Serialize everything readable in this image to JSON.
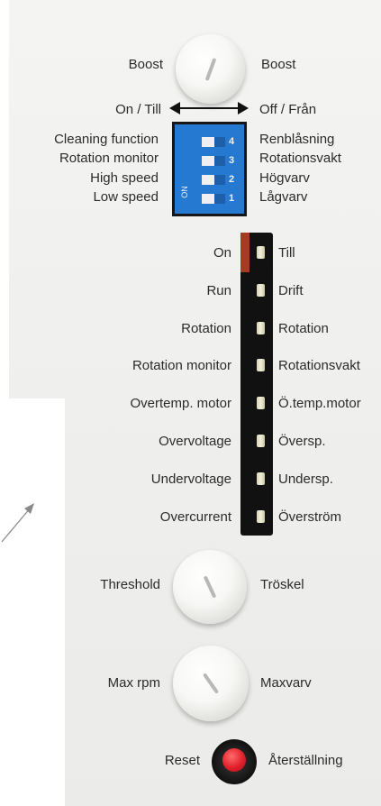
{
  "boost": {
    "left": "Boost",
    "right": "Boost"
  },
  "direction": {
    "left": "On / Till",
    "right": "Off / Från"
  },
  "dip_switch": {
    "left_labels": [
      "Cleaning function",
      "Rotation monitor",
      "High speed",
      "Low speed"
    ],
    "right_labels": [
      "Renblåsning",
      "Rotationsvakt",
      "Högvarv",
      "Lågvarv"
    ],
    "numbers": [
      "4",
      "3",
      "2",
      "1"
    ],
    "on_label": "ON"
  },
  "indicators": [
    {
      "left": "On",
      "right": "Till"
    },
    {
      "left": "Run",
      "right": "Drift"
    },
    {
      "left": "Rotation",
      "right": "Rotation"
    },
    {
      "left": "Rotation monitor",
      "right": "Rotationsvakt"
    },
    {
      "left": "Overtemp. motor",
      "right": "Ö.temp.motor"
    },
    {
      "left": "Overvoltage",
      "right": "Översp."
    },
    {
      "left": "Undervoltage",
      "right": "Undersp."
    },
    {
      "left": "Overcurrent",
      "right": "Överström"
    }
  ],
  "threshold": {
    "left": "Threshold",
    "right": "Tröskel"
  },
  "max_rpm": {
    "left": "Max rpm",
    "right": "Maxvarv"
  },
  "reset": {
    "left": "Reset",
    "right": "Återställning"
  },
  "colors": {
    "dip_blue": "#2579d0",
    "reset_red": "#e0202a",
    "panel": "#efefed"
  }
}
